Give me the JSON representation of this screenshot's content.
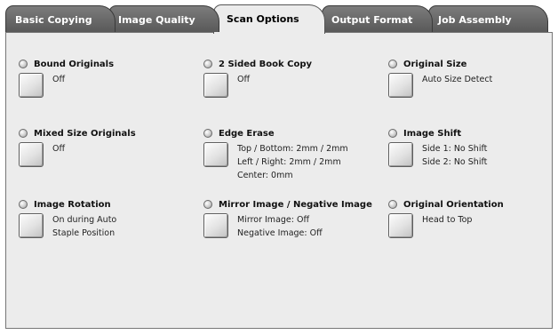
{
  "tabs": [
    {
      "label": "Basic Copying",
      "active": false
    },
    {
      "label": "Image Quality",
      "active": false
    },
    {
      "label": "Scan Options",
      "active": true
    },
    {
      "label": "Output Format",
      "active": false
    },
    {
      "label": "Job Assembly",
      "active": false
    }
  ],
  "options": {
    "bound_originals": {
      "title": "Bound Originals",
      "values": [
        "Off"
      ]
    },
    "two_sided_book_copy": {
      "title": "2 Sided Book Copy",
      "values": [
        "Off"
      ]
    },
    "original_size": {
      "title": "Original Size",
      "values": [
        "Auto Size Detect"
      ]
    },
    "mixed_size_originals": {
      "title": "Mixed Size Originals",
      "values": [
        "Off"
      ]
    },
    "edge_erase": {
      "title": "Edge Erase",
      "values": [
        "Top / Bottom: 2mm / 2mm",
        "Left / Right: 2mm / 2mm",
        "Center: 0mm"
      ]
    },
    "image_shift": {
      "title": "Image Shift",
      "values": [
        "Side 1: No Shift",
        "Side 2: No Shift"
      ]
    },
    "image_rotation": {
      "title": "Image Rotation",
      "values": [
        "On during Auto",
        "Staple Position"
      ]
    },
    "mirror_negative_image": {
      "title": "Mirror Image / Negative Image",
      "values": [
        "Mirror Image: Off",
        "Negative Image: Off"
      ]
    },
    "original_orientation": {
      "title": "Original Orientation",
      "values": [
        "Head to Top"
      ]
    }
  }
}
